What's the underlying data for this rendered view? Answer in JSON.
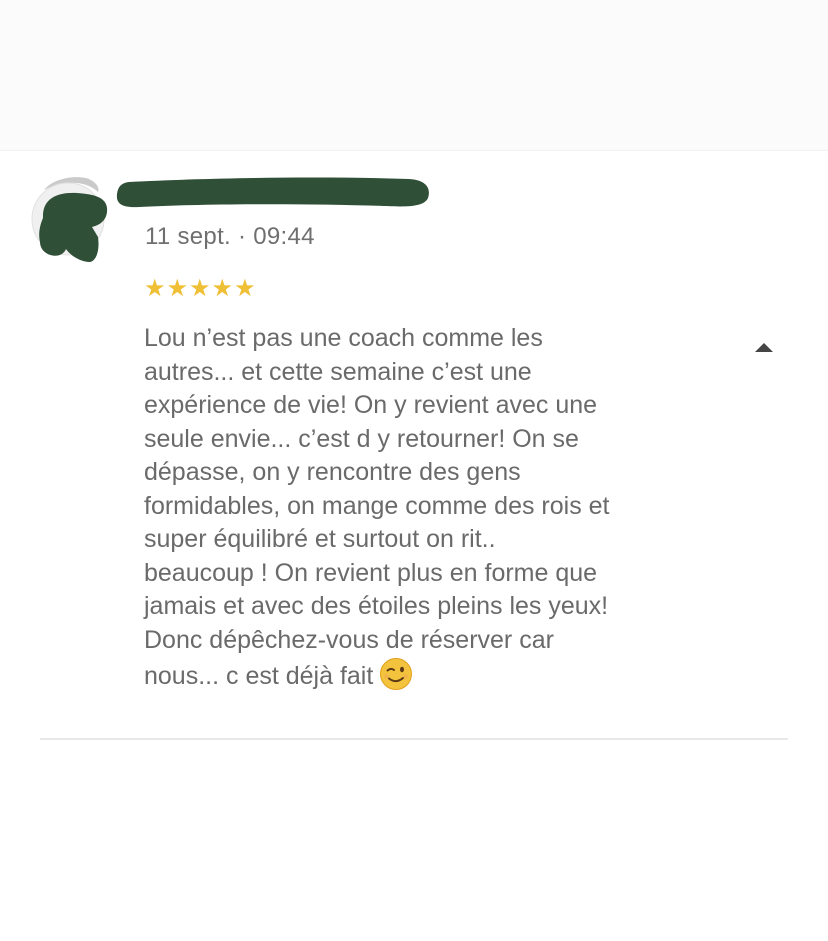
{
  "review": {
    "date": "11 sept. · 09:44",
    "rating": 5,
    "max_rating": 5,
    "stars": [
      "★",
      "★",
      "★",
      "★",
      "★"
    ],
    "text": "Lou n’est pas une coach comme les\nautres... et cette semaine c’est une\nexpérience de vie! On y revient avec une\nseule envie... c’est d y retourner! On se\ndépasse, on y rencontre des gens\nformidables, on mange comme des rois et\nsuper équilibré et surtout on rit..\nbeaucoup ! On revient plus en forme que\njamais et avec des étoiles pleins les yeux!\nDonc dépêchez-vous de réserver car\nnous... c est déjà fait",
    "emoji": "winking-face"
  },
  "icons": {
    "collapse": "chevron-up-icon",
    "emoji": "winking-face-icon"
  },
  "colors": {
    "text": "#6a6a6a",
    "star": "#efbf36",
    "redaction": "#2f4f37",
    "divider": "#e8e8e8"
  }
}
